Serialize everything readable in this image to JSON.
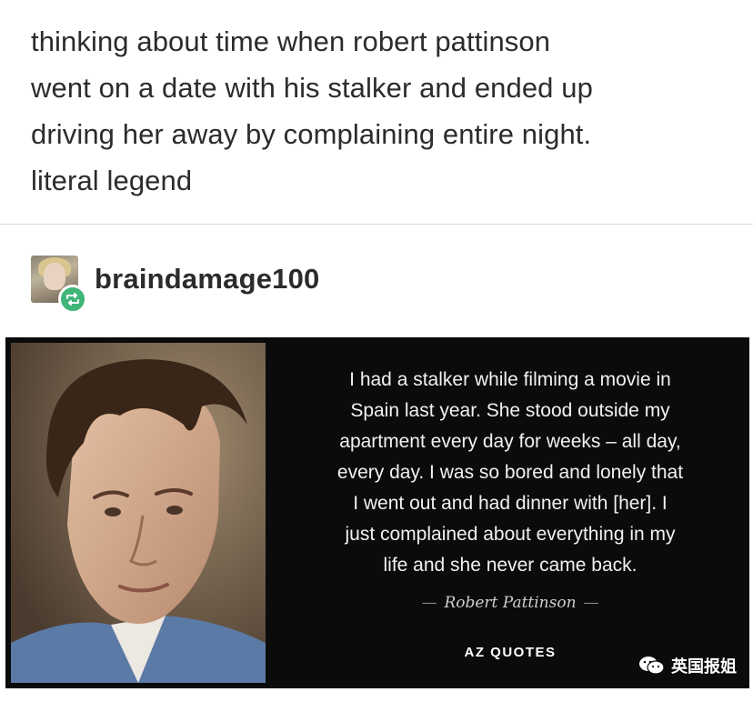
{
  "post": {
    "line1": "thinking about time when robert pattinson",
    "line2": "went on a date with his stalker and ended up",
    "line3": "driving her away by complaining entire night.",
    "line4": "literal legend"
  },
  "reblog": {
    "username": "braindamage100"
  },
  "quote_card": {
    "lines": [
      "I had a stalker while filming a movie in",
      "Spain last year. She stood outside my",
      "apartment every day for weeks – all day,",
      "every day. I was so bored and lonely that",
      "I went out and had dinner with [her]. I",
      "just complained about everything in my",
      "life and she never came back."
    ],
    "attribution": "Robert Pattinson",
    "attribution_dash": "—",
    "brand": "AZ QUOTES"
  },
  "watermark": {
    "text": "英国报姐"
  },
  "colors": {
    "reblog_badge": "#3fb57a",
    "card_background": "#0b0b0b",
    "text": "#2c2c2c"
  }
}
